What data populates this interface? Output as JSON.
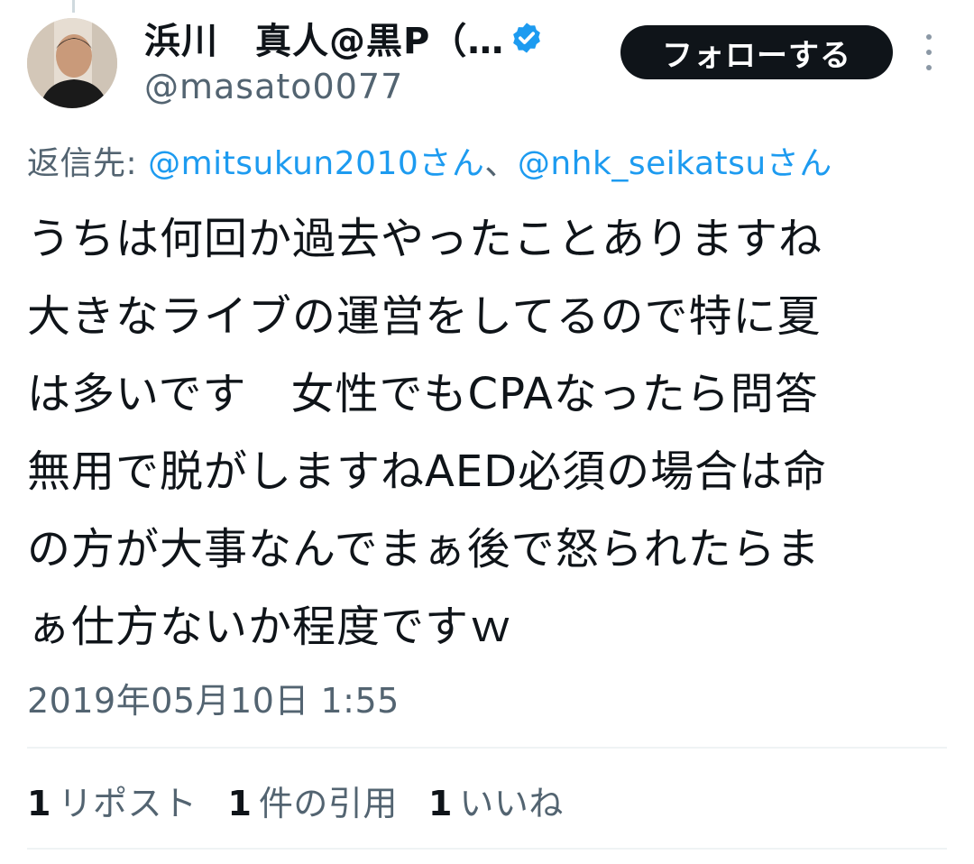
{
  "author": {
    "display_name": "浜川　真人@黒P（…",
    "handle": "@masato0077",
    "verified_icon": "verified-badge-icon"
  },
  "actions": {
    "follow_label": "フォローする",
    "more_icon": "more-options-icon"
  },
  "reply": {
    "prefix": "返信先: ",
    "mentions": [
      "@mitsukun2010さん",
      "@nhk_seikatsuさん"
    ],
    "separator": "、"
  },
  "tweet": {
    "text": "うちは何回か過去やったことありますね\n大きなライブの運営をしてるので特に夏\nは多いです　女性でもCPAなったら問答\n無用で脱がしますねAED必須の場合は命\nの方が大事なんでまぁ後で怒られたらま\nぁ仕方ないか程度ですｗ",
    "timestamp": "2019年05月10日 1:55"
  },
  "stats": [
    {
      "count": "1",
      "label": "リポスト"
    },
    {
      "count": "1",
      "label": "件の引用"
    },
    {
      "count": "1",
      "label": "いいね"
    }
  ],
  "colors": {
    "text_primary": "#0f1419",
    "text_secondary": "#536471",
    "link": "#1d9bf0",
    "button_bg": "#0f1419",
    "divider": "#eff3f4"
  }
}
